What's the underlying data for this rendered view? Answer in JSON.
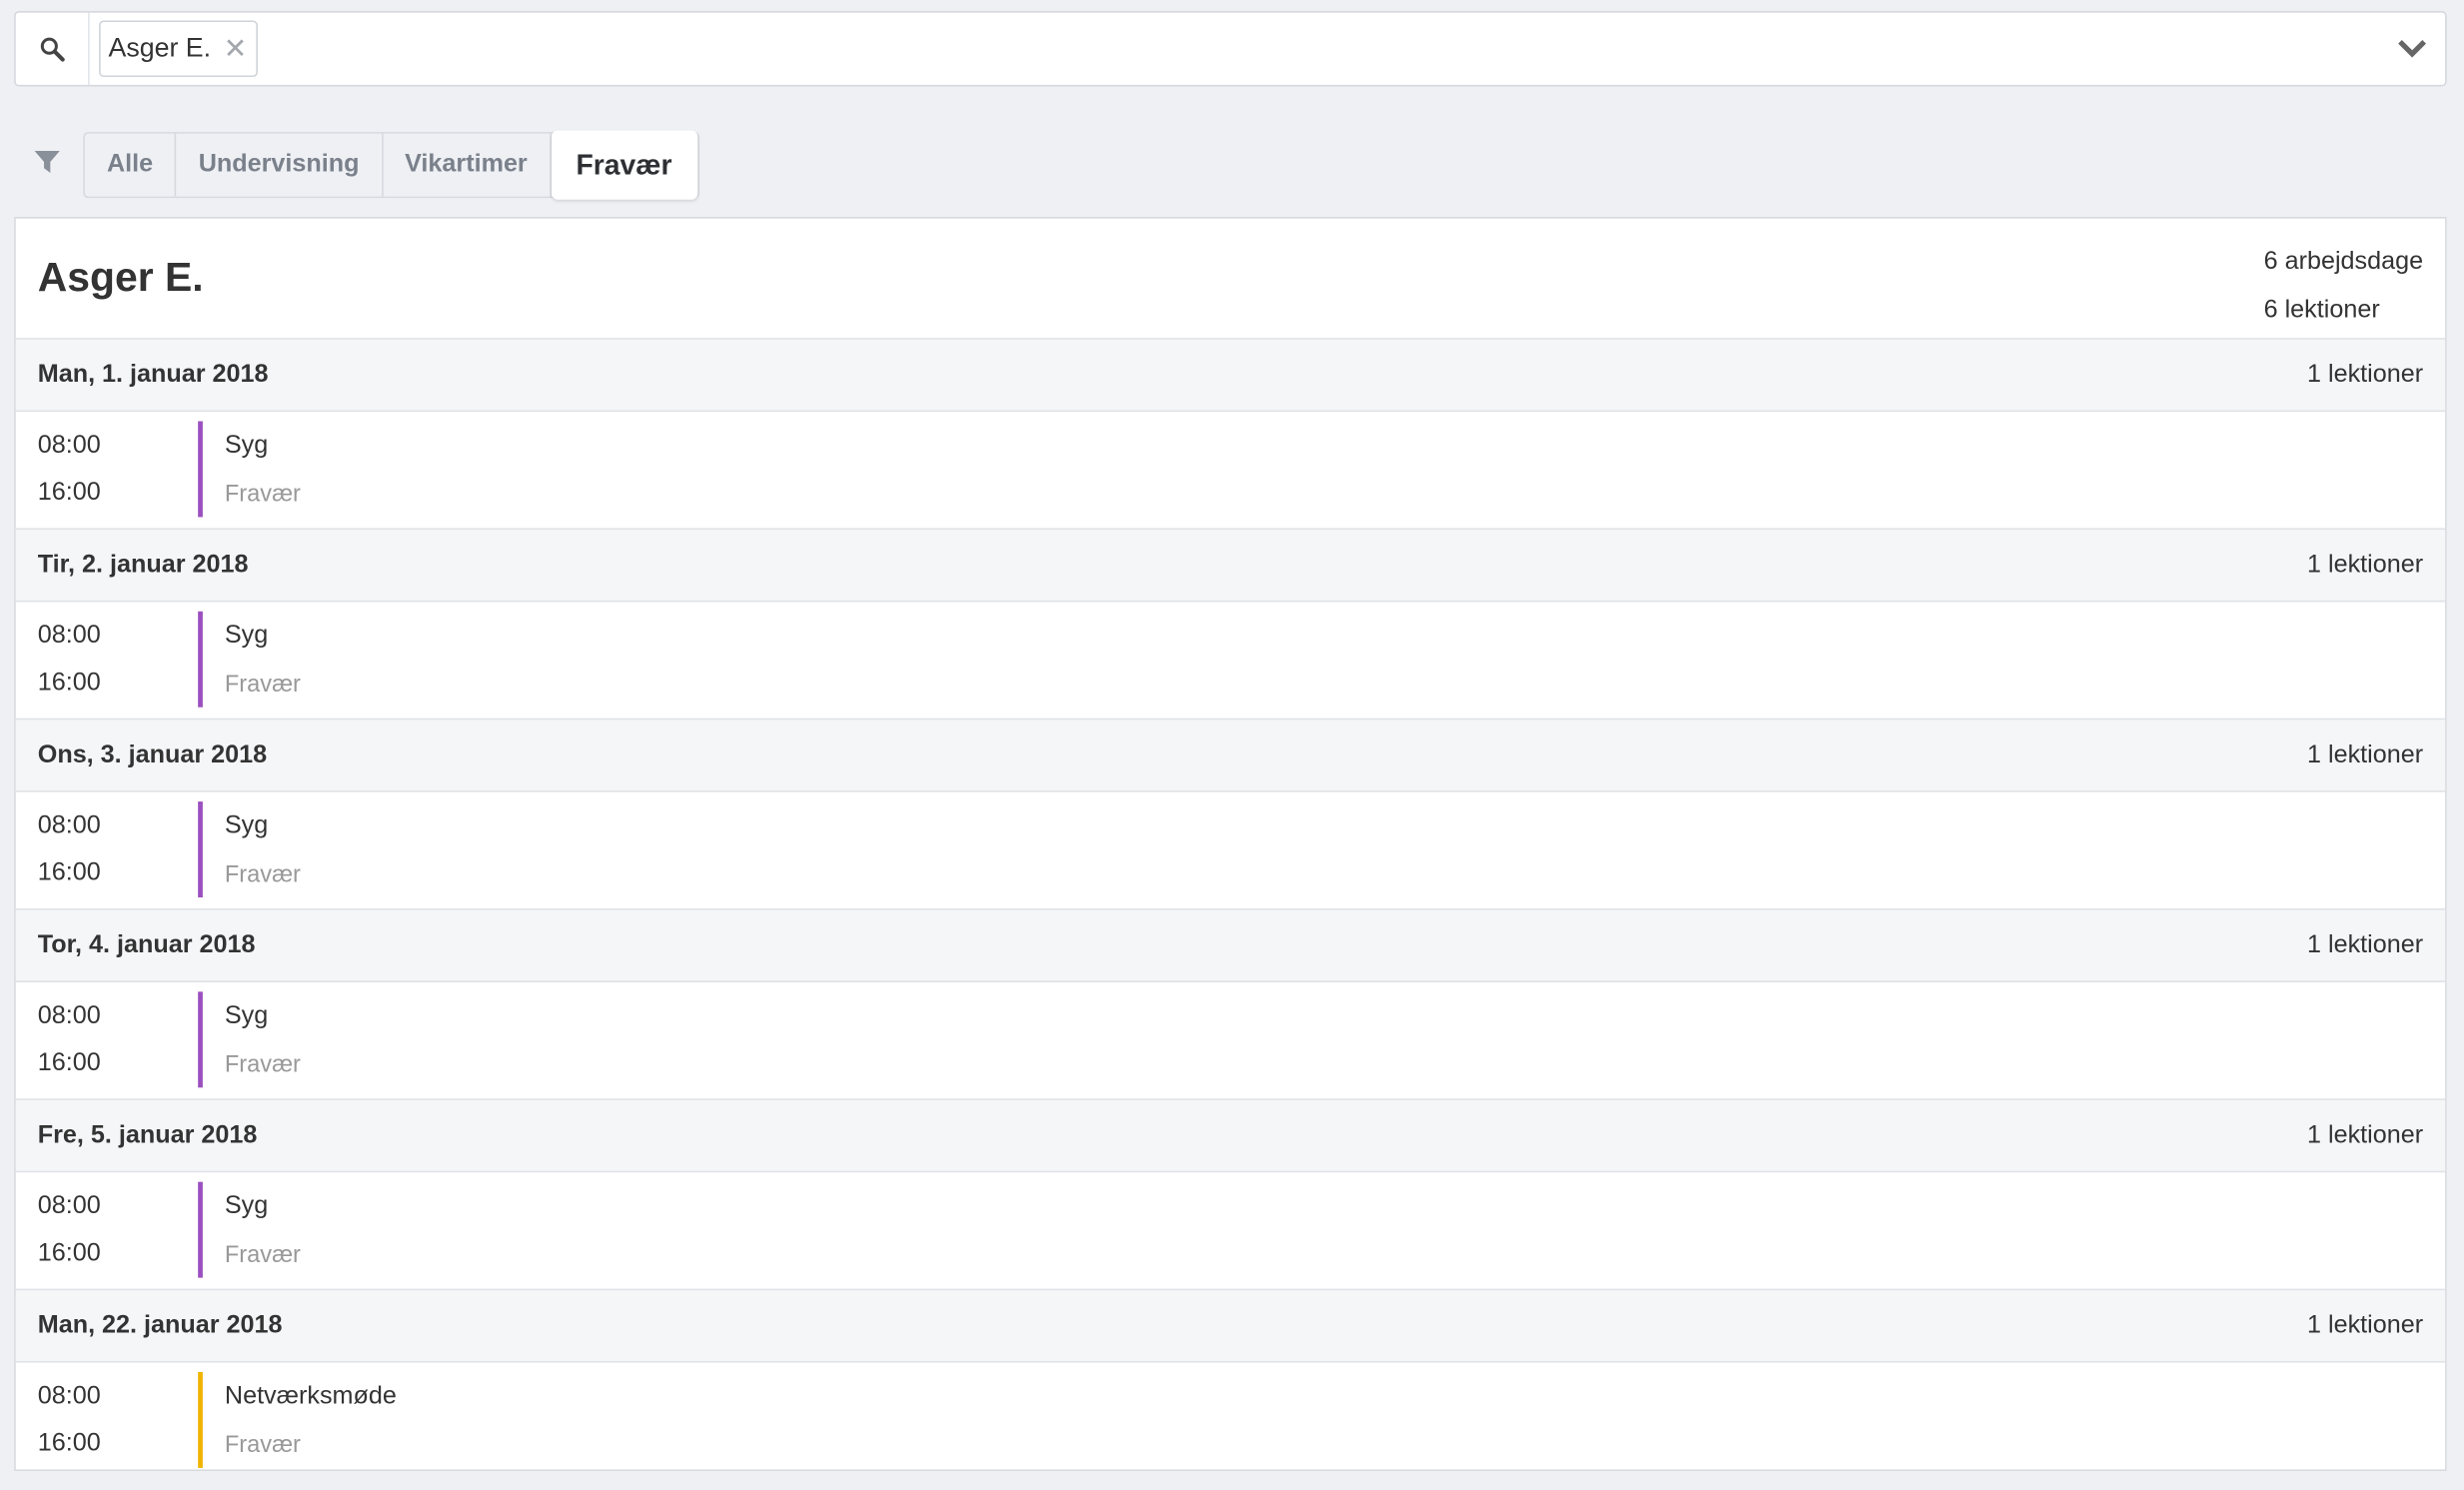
{
  "search": {
    "token": "Asger E."
  },
  "filters": {
    "tabs": [
      "Alle",
      "Undervisning",
      "Vikartimer",
      "Fravær"
    ],
    "active": "Fravær"
  },
  "panel": {
    "title": "Asger E.",
    "summary_days": "6 arbejdsdage",
    "summary_lessons": "6 lektioner"
  },
  "days": [
    {
      "date": "Man, 1. januar 2018",
      "count": "1 lektioner",
      "start": "08:00",
      "end": "16:00",
      "title": "Syg",
      "type": "Fravær",
      "color": "#9b4fbf"
    },
    {
      "date": "Tir, 2. januar 2018",
      "count": "1 lektioner",
      "start": "08:00",
      "end": "16:00",
      "title": "Syg",
      "type": "Fravær",
      "color": "#9b4fbf"
    },
    {
      "date": "Ons, 3. januar 2018",
      "count": "1 lektioner",
      "start": "08:00",
      "end": "16:00",
      "title": "Syg",
      "type": "Fravær",
      "color": "#9b4fbf"
    },
    {
      "date": "Tor, 4. januar 2018",
      "count": "1 lektioner",
      "start": "08:00",
      "end": "16:00",
      "title": "Syg",
      "type": "Fravær",
      "color": "#9b4fbf"
    },
    {
      "date": "Fre, 5. januar 2018",
      "count": "1 lektioner",
      "start": "08:00",
      "end": "16:00",
      "title": "Syg",
      "type": "Fravær",
      "color": "#9b4fbf"
    },
    {
      "date": "Man, 22. januar 2018",
      "count": "1 lektioner",
      "start": "08:00",
      "end": "16:00",
      "title": "Netværksmøde",
      "type": "Fravær",
      "color": "#f0b400"
    }
  ]
}
